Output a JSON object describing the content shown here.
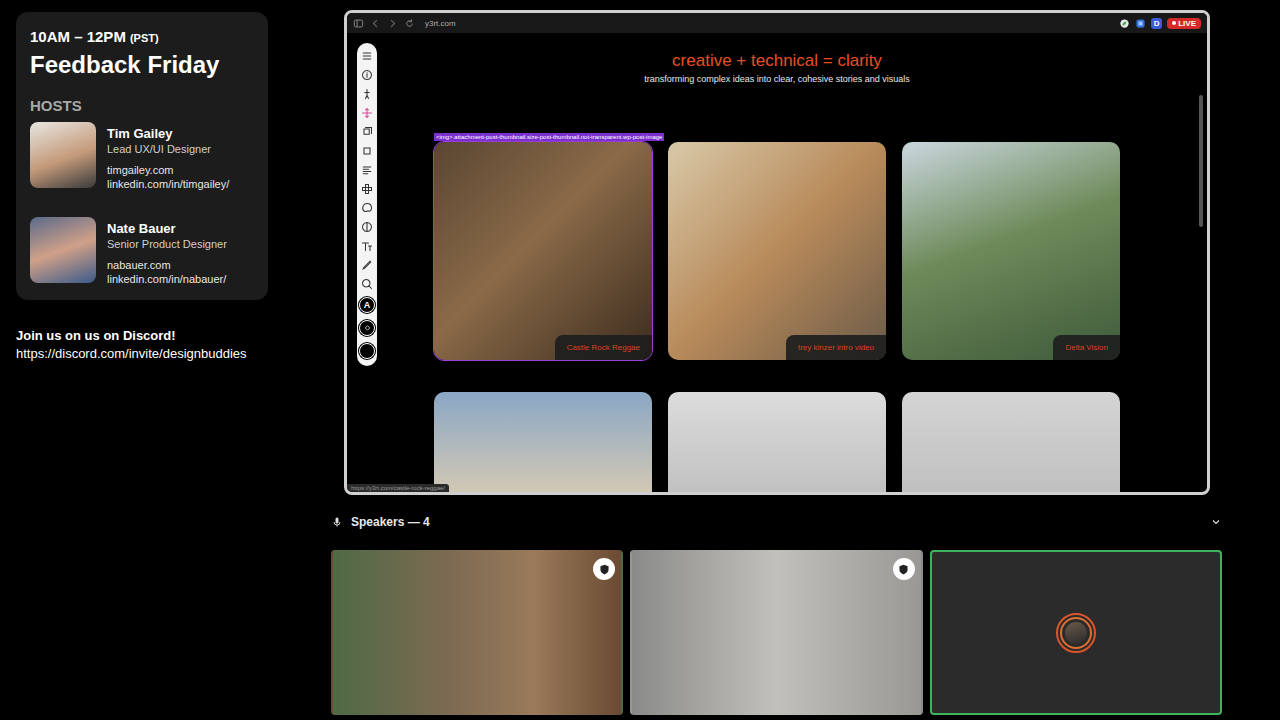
{
  "schedule": {
    "time": "10AM – 12PM",
    "zone": "(PST)",
    "title": "Feedback Friday"
  },
  "hosts_heading": "HOSTS",
  "hosts": [
    {
      "name": "Tim Gailey",
      "role": "Lead UX/UI Designer",
      "site": "timgailey.com",
      "linkedin": "linkedin.com/in/timgailey/"
    },
    {
      "name": "Nate Bauer",
      "role": "Senior Product Designer",
      "site": "nabauer.com",
      "linkedin": "linkedin.com/in/nabauer/"
    }
  ],
  "discord": {
    "heading": "Join us on us on Discord!",
    "url": "https://discord.com/invite/designbuddies"
  },
  "browser": {
    "url": "y3rt.com",
    "extension_letter": "D",
    "live_badge": "LIVE",
    "status_url": "https://y3rt.com/castle-rock-reggae/"
  },
  "toolbar": {
    "tools": [
      {
        "selected": false
      },
      {
        "selected": false
      },
      {
        "selected": false
      },
      {
        "selected": true
      },
      {
        "selected": false
      },
      {
        "selected": false
      },
      {
        "selected": false
      },
      {
        "selected": false
      },
      {
        "selected": false
      },
      {
        "selected": false
      },
      {
        "selected": false
      },
      {
        "selected": false
      },
      {
        "selected": false
      }
    ],
    "text_tool": "A"
  },
  "site": {
    "headline": "creative + technical = clarity",
    "tagline": "transforming complex ideas into clear, cohesive stories and visuals",
    "inspector_tag": "<img>.attachment-post-thumbnail.size-post-thumbnail.not-transparent.wp-post-image",
    "cards": [
      {
        "label": "Castle Rock Reggae",
        "inspected": true
      },
      {
        "label": "trey kinzer intro video",
        "inspected": false
      },
      {
        "label": "Delta Vision",
        "inspected": false
      }
    ],
    "more_cards": [
      {
        "inspected": false
      },
      {
        "inspected": false
      },
      {
        "inspected": false
      }
    ]
  },
  "speakers": {
    "label": "Speakers — 4",
    "tiles": [
      {
        "moderator": true,
        "speaking": false
      },
      {
        "moderator": true,
        "speaking": false
      },
      {
        "moderator": false,
        "speaking": true
      }
    ]
  }
}
